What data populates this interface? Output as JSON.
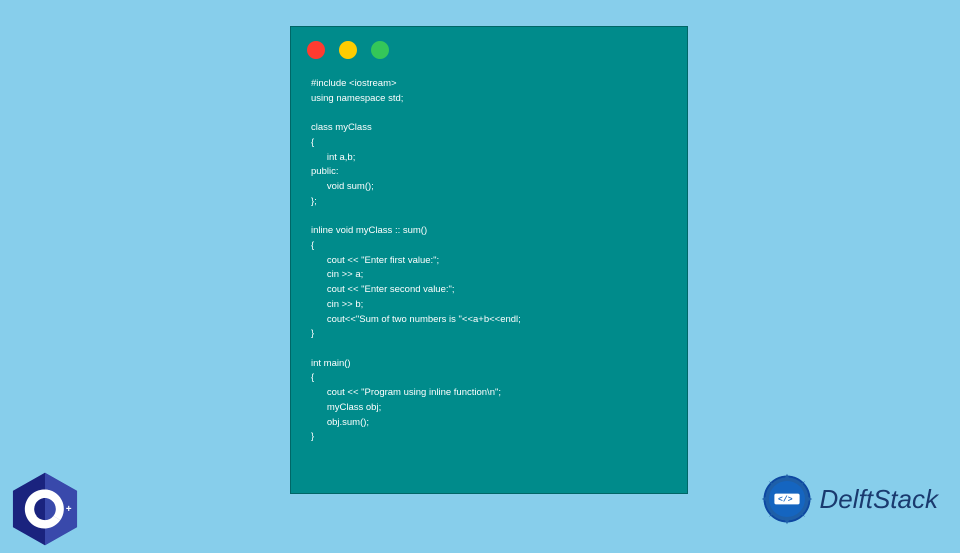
{
  "window": {
    "dots": [
      "red",
      "yellow",
      "green"
    ]
  },
  "code": "#include <iostream>\nusing namespace std;\n\nclass myClass\n{\n      int a,b;\npublic:\n      void sum();\n};\n\ninline void myClass :: sum()\n{\n      cout << \"Enter first value:\";\n      cin >> a;\n      cout << \"Enter second value:\";\n      cin >> b;\n      cout<<\"Sum of two numbers is \"<<a+b<<endl;\n}\n\nint main()\n{\n      cout << \"Program using inline function\\n\";\n      myClass obj;\n      obj.sum();\n}",
  "brand": {
    "cpp_label": "C++",
    "delft_label": "DelftStack"
  },
  "colors": {
    "bg": "#87ceeb",
    "window_bg": "#008b8b",
    "code_text": "#ffffff",
    "cpp_blue": "#283593",
    "delft_blue": "#1a3a6e"
  }
}
